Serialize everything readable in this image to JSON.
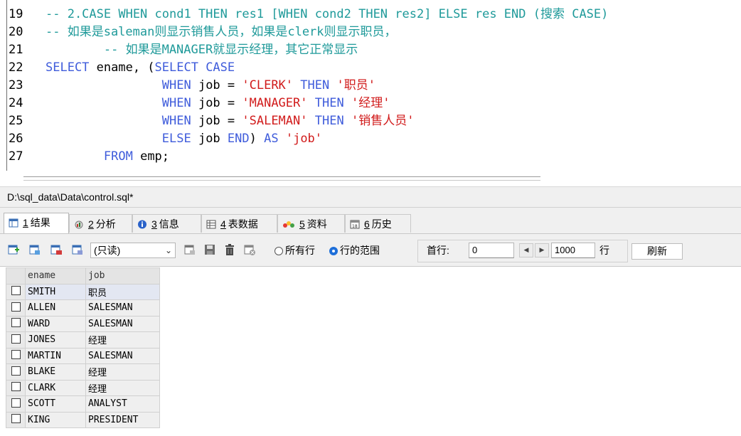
{
  "editor": {
    "lines": [
      {
        "num": "19",
        "tokens": [
          {
            "t": "-- 2.CASE WHEN cond1 THEN res1 [WHEN cond2 THEN res2] ELSE res END (搜索 CASE)",
            "c": "c-cmt"
          }
        ]
      },
      {
        "num": "20",
        "tokens": [
          {
            "t": "-- 如果是saleman则显示销售人员，如果是clerk则显示职员，",
            "c": "c-cmt"
          }
        ]
      },
      {
        "num": "21",
        "tokens": [
          {
            "t": "        -- 如果是MANAGER就显示经理，其它正常显示",
            "c": "c-cmt"
          }
        ]
      },
      {
        "num": "22",
        "tokens": [
          {
            "t": "SELECT",
            "c": "c-kw"
          },
          {
            "t": " ename, (",
            "c": "c-id"
          },
          {
            "t": "SELECT CASE",
            "c": "c-kw"
          }
        ]
      },
      {
        "num": "23",
        "tokens": [
          {
            "t": "                ",
            "c": "c-id"
          },
          {
            "t": "WHEN",
            "c": "c-kw"
          },
          {
            "t": " job = ",
            "c": "c-id"
          },
          {
            "t": "'CLERK'",
            "c": "c-str"
          },
          {
            "t": " ",
            "c": "c-id"
          },
          {
            "t": "THEN",
            "c": "c-kw"
          },
          {
            "t": " ",
            "c": "c-id"
          },
          {
            "t": "'职员'",
            "c": "c-str"
          }
        ]
      },
      {
        "num": "24",
        "tokens": [
          {
            "t": "                ",
            "c": "c-id"
          },
          {
            "t": "WHEN",
            "c": "c-kw"
          },
          {
            "t": " job = ",
            "c": "c-id"
          },
          {
            "t": "'MANAGER'",
            "c": "c-str"
          },
          {
            "t": " ",
            "c": "c-id"
          },
          {
            "t": "THEN",
            "c": "c-kw"
          },
          {
            "t": " ",
            "c": "c-id"
          },
          {
            "t": "'经理'",
            "c": "c-str"
          }
        ]
      },
      {
        "num": "25",
        "tokens": [
          {
            "t": "                ",
            "c": "c-id"
          },
          {
            "t": "WHEN",
            "c": "c-kw"
          },
          {
            "t": " job = ",
            "c": "c-id"
          },
          {
            "t": "'SALEMAN'",
            "c": "c-str"
          },
          {
            "t": " ",
            "c": "c-id"
          },
          {
            "t": "THEN",
            "c": "c-kw"
          },
          {
            "t": " ",
            "c": "c-id"
          },
          {
            "t": "'销售人员'",
            "c": "c-str"
          }
        ]
      },
      {
        "num": "26",
        "tokens": [
          {
            "t": "                ",
            "c": "c-id"
          },
          {
            "t": "ELSE",
            "c": "c-kw"
          },
          {
            "t": " job ",
            "c": "c-id"
          },
          {
            "t": "END",
            "c": "c-kw"
          },
          {
            "t": ") ",
            "c": "c-id"
          },
          {
            "t": "AS",
            "c": "c-kw"
          },
          {
            "t": " ",
            "c": "c-id"
          },
          {
            "t": "'job'",
            "c": "c-str"
          }
        ]
      },
      {
        "num": "27",
        "tokens": [
          {
            "t": "        ",
            "c": "c-id"
          },
          {
            "t": "FROM",
            "c": "c-kw"
          },
          {
            "t": " emp;",
            "c": "c-id"
          }
        ]
      }
    ]
  },
  "file_path": "D:\\sql_data\\Data\\control.sql*",
  "tabs": [
    {
      "num": "1",
      "label": "结果",
      "icon": "result-grid-icon"
    },
    {
      "num": "2",
      "label": "分析",
      "icon": "profiler-icon"
    },
    {
      "num": "3",
      "label": "信息",
      "icon": "info-icon"
    },
    {
      "num": "4",
      "label": "表数据",
      "icon": "table-data-icon"
    },
    {
      "num": "5",
      "label": "资料",
      "icon": "info-tab-icon"
    },
    {
      "num": "6",
      "label": "历史",
      "icon": "history-icon"
    }
  ],
  "toolbar": {
    "mode": "(只读)",
    "radio_all": "所有行",
    "radio_range": "行的范围",
    "first_row_label": "首行:",
    "first_row_value": "0",
    "row_count_value": "1000",
    "row_unit": "行",
    "refresh": "刷新"
  },
  "grid": {
    "columns": [
      "ename",
      "job"
    ],
    "rows": [
      [
        "SMITH",
        "职员"
      ],
      [
        "ALLEN",
        "SALESMAN"
      ],
      [
        "WARD",
        "SALESMAN"
      ],
      [
        "JONES",
        "经理"
      ],
      [
        "MARTIN",
        "SALESMAN"
      ],
      [
        "BLAKE",
        "经理"
      ],
      [
        "CLARK",
        "经理"
      ],
      [
        "SCOTT",
        "ANALYST"
      ],
      [
        "KING",
        "PRESIDENT"
      ]
    ]
  },
  "colors": {
    "comment": "#1f9a9a",
    "keyword": "#3f5cdb",
    "string": "#d11b1b",
    "radio_on": "#1e6fd9"
  }
}
